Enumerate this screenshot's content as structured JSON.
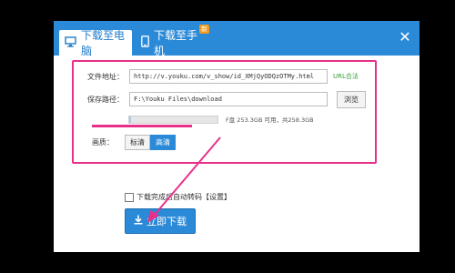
{
  "tabs": [
    {
      "label": "下载至电脑",
      "icon": "monitor-icon",
      "active": true
    },
    {
      "label": "下载至手机",
      "icon": "phone-icon",
      "active": false,
      "badge": "新"
    }
  ],
  "form": {
    "file_address_label": "文件地址：",
    "file_address_value": "http://v.youku.com/v_show/id_XMjQyODQzOTMy.html",
    "url_status": "URL合法",
    "save_path_label": "保存路径：",
    "save_path_value": "F:\\Youku Files\\download",
    "browse_label": "浏览",
    "disk_info": "F盘  253.3GB 可用，共258.3GB",
    "disk_usage_fraction": 0.02,
    "quality_label": "画质：",
    "quality_options": [
      "标清",
      "高清"
    ],
    "quality_selected_index": 1
  },
  "footer": {
    "auto_transcode_label": "下载完成后自动转码【设置】",
    "auto_transcode_checked": false,
    "download_button": "立即下载"
  },
  "colors": {
    "accent": "#2b8ad8",
    "annotation": "#e8308a"
  }
}
